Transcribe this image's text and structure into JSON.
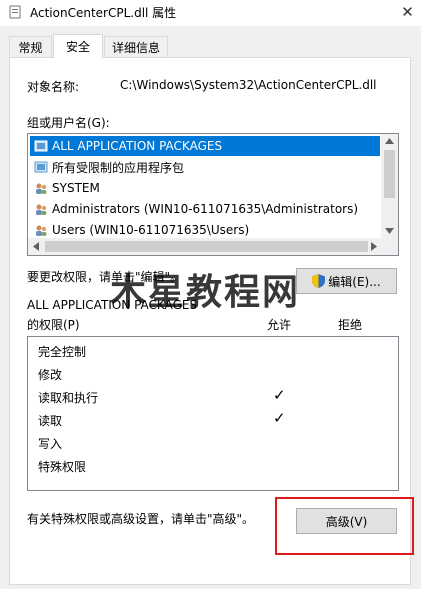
{
  "window": {
    "title": "ActionCenterCPL.dll 属性",
    "close_glyph": "✕"
  },
  "tabs": [
    {
      "label": "常规",
      "active": false
    },
    {
      "label": "安全",
      "active": true
    },
    {
      "label": "详细信息",
      "active": false
    }
  ],
  "object": {
    "label": "对象名称:",
    "value": "C:\\Windows\\System32\\ActionCenterCPL.dll"
  },
  "groups": {
    "label": "组或用户名(G):",
    "items": [
      {
        "name": "ALL APPLICATION PACKAGES",
        "icon": "app-package-icon",
        "selected": true
      },
      {
        "name": "所有受限制的应用程序包",
        "icon": "app-package-icon",
        "selected": false
      },
      {
        "name": "SYSTEM",
        "icon": "users-group-icon",
        "selected": false
      },
      {
        "name": "Administrators (WIN10-611071635\\Administrators)",
        "icon": "users-group-icon",
        "selected": false
      },
      {
        "name": "Users (WIN10-611071635\\Users)",
        "icon": "users-group-icon",
        "selected": false
      }
    ]
  },
  "edit": {
    "hint": "要更改权限，请单击\"编辑\"。",
    "button_label": "编辑(E)..."
  },
  "permissions": {
    "header_subject": "ALL APPLICATION PACKAGES",
    "header_label": "的权限(P)",
    "allow_label": "允许",
    "deny_label": "拒绝",
    "rows": [
      {
        "name": "完全控制",
        "allow": false,
        "deny": false
      },
      {
        "name": "修改",
        "allow": false,
        "deny": false
      },
      {
        "name": "读取和执行",
        "allow": true,
        "deny": false
      },
      {
        "name": "读取",
        "allow": true,
        "deny": false
      },
      {
        "name": "写入",
        "allow": false,
        "deny": false
      },
      {
        "name": "特殊权限",
        "allow": false,
        "deny": false
      }
    ],
    "check_glyph": "✓"
  },
  "advanced": {
    "hint": "有关特殊权限或高级设置，请单击\"高级\"。",
    "button_label": "高级(V)"
  },
  "watermark": "木星教程网",
  "colors": {
    "selection": "#0078d7",
    "highlight_box": "#e01b1b"
  }
}
